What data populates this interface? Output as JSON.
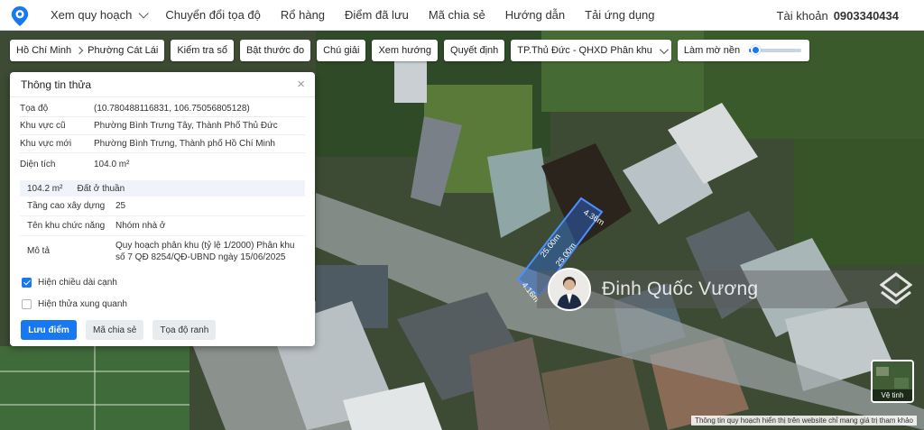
{
  "nav": {
    "items": [
      "Xem quy hoạch",
      "Chuyển đổi tọa độ",
      "Rổ hàng",
      "Điểm đã lưu",
      "Mã chia sẻ",
      "Hướng dẫn",
      "Tải ứng dụng"
    ],
    "account_label": "Tài khoản",
    "account_phone": "0903340434"
  },
  "toolbar": {
    "breadcrumb": [
      "Hồ Chí Minh",
      "Phường Cát Lái"
    ],
    "buttons": [
      "Kiểm tra sổ",
      "Bật thước đo",
      "Chú giải",
      "Xem hướng",
      "Quyết định"
    ],
    "plan_select": "TP.Thủ Đức - QHXD Phân khu",
    "opacity_label": "Làm mờ nền",
    "opacity_value": 0.05
  },
  "panel": {
    "title": "Thông tin thửa",
    "close": "×",
    "fields": [
      {
        "label": "Tọa độ",
        "value": "(10.780488116831, 106.75056805128)"
      },
      {
        "label": "Khu vực cũ",
        "value": "Phường Bình Trưng Tây, Thành Phố Thủ Đức"
      },
      {
        "label": "Khu vực mới",
        "value": "Phường Bình Trưng, Thành phố Hồ Chí Minh"
      },
      {
        "label": "Diện tích",
        "value": "104.0 m²"
      }
    ],
    "zone": {
      "area": "104.2 m²",
      "land_type": "Đất ở thuần",
      "rows": [
        {
          "label": "Tầng cao xây dựng",
          "value": "25"
        },
        {
          "label": "Tên khu chức năng",
          "value": "Nhóm nhà ở"
        },
        {
          "label": "Mô tả",
          "value": "Quy hoạch phân khu (tỷ lệ 1/2000) Phân khu số 7 QĐ 8254/QĐ-UBND ngày 15/06/2025"
        }
      ]
    },
    "checkboxes": [
      {
        "label": "Hiện chiều dài cạnh",
        "checked": true
      },
      {
        "label": "Hiện thửa xung quanh",
        "checked": false
      }
    ],
    "actions": [
      "Lưu điểm",
      "Mã chia sẻ",
      "Tọa độ ranh"
    ]
  },
  "map": {
    "parcel_edges": [
      "25.00m",
      "4.36m",
      "25.00m",
      "4.16m"
    ],
    "owner_name": "Đinh Quốc Vương",
    "layer_toggle_label": "Vệ tinh",
    "disclaimer": "Thông tin quy hoạch hiển thị trên website chỉ mang giá trị tham khảo"
  },
  "colors": {
    "accent": "#1877f2",
    "parcel_fill": "#2a6bd6"
  }
}
